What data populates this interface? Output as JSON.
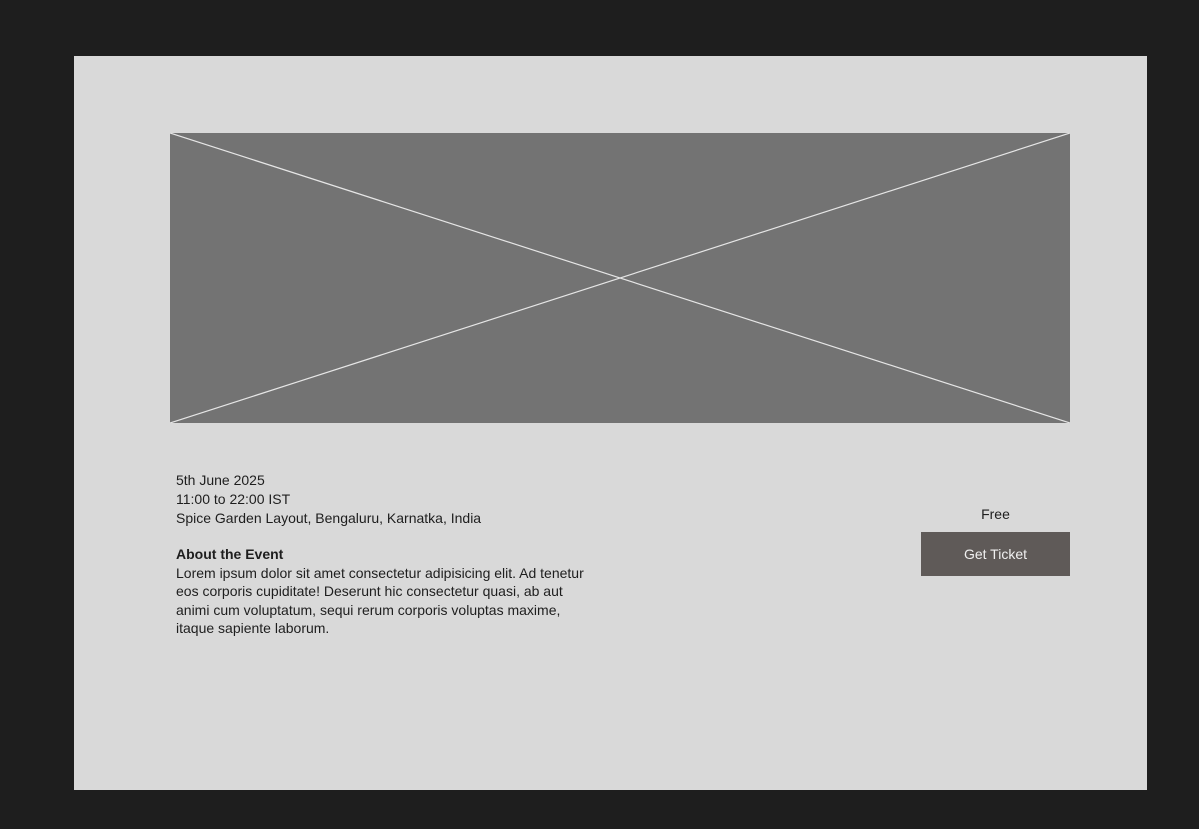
{
  "event": {
    "date": "5th June 2025",
    "time": "11:00 to 22:00 IST",
    "location": "Spice Garden Layout, Bengaluru, Karnatka, India"
  },
  "about": {
    "title": "About the Event",
    "body": "Lorem ipsum dolor sit amet consectetur adipisicing elit. Ad tenetur eos corporis cupiditate! Deserunt hic consectetur quasi, ab aut animi cum voluptatum, sequi rerum corporis voluptas maxime, itaque sapiente laborum."
  },
  "ticket": {
    "price": "Free",
    "button_label": "Get Ticket"
  },
  "colors": {
    "frame": "#1e1e1e",
    "page_background": "#d9d9d9",
    "image_placeholder": "#737373",
    "button": "#5f5a58"
  },
  "icons": {
    "hero": "image-placeholder-icon"
  }
}
